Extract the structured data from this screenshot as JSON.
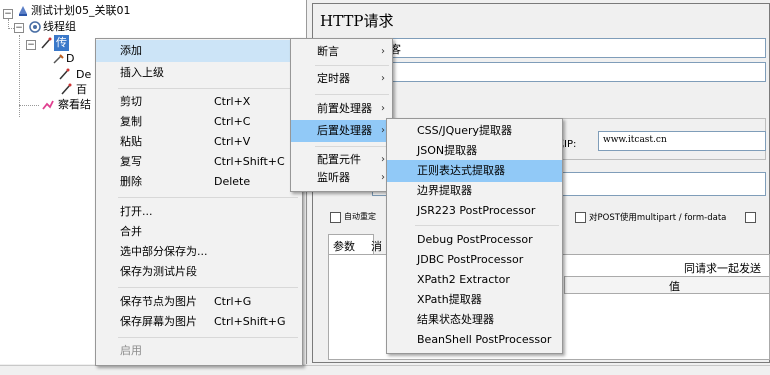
{
  "tree": {
    "items": [
      {
        "label": "测试计划05_关联01"
      },
      {
        "label": "线程组"
      },
      {
        "label": "传"
      },
      {
        "label": "D"
      },
      {
        "label": "De"
      },
      {
        "label": "百"
      },
      {
        "label": "察看结"
      }
    ]
  },
  "sampler": {
    "title": "HTTP请求",
    "name_value_partial": "客",
    "server_label_partial": "或IP:",
    "server_value": "www.itcast.cn",
    "checkbox_redirect": "自动重定",
    "checkbox_post": "对POST使用multipart / form-data",
    "tabs": [
      "参数",
      "消息"
    ],
    "send_params_partial": "同请求一起发送",
    "value_header": "值"
  },
  "context_menu": {
    "items": [
      {
        "label": "添加",
        "shortcut": "",
        "submenu": true
      },
      {
        "label": "插入上级",
        "shortcut": "",
        "submenu": true
      },
      {
        "label": "剪切",
        "shortcut": "Ctrl+X"
      },
      {
        "label": "复制",
        "shortcut": "Ctrl+C"
      },
      {
        "label": "粘贴",
        "shortcut": "Ctrl+V"
      },
      {
        "label": "复写",
        "shortcut": "Ctrl+Shift+C"
      },
      {
        "label": "删除",
        "shortcut": "Delete"
      },
      {
        "label": "打开..."
      },
      {
        "label": "合并"
      },
      {
        "label": "选中部分保存为..."
      },
      {
        "label": "保存为测试片段"
      },
      {
        "label": "保存节点为图片",
        "shortcut": "Ctrl+G"
      },
      {
        "label": "保存屏幕为图片",
        "shortcut": "Ctrl+Shift+G"
      },
      {
        "label": "启用"
      }
    ]
  },
  "add_submenu": {
    "items": [
      {
        "label": "断言"
      },
      {
        "label": "定时器"
      },
      {
        "label": "前置处理器"
      },
      {
        "label": "后置处理器"
      },
      {
        "label": "配置元件"
      },
      {
        "label": "监听器"
      }
    ]
  },
  "post_processor_submenu": {
    "items": [
      {
        "label": "CSS/JQuery提取器"
      },
      {
        "label": "JSON提取器"
      },
      {
        "label": "正则表达式提取器"
      },
      {
        "label": "边界提取器"
      },
      {
        "label": "JSR223 PostProcessor"
      },
      {
        "label": "Debug PostProcessor"
      },
      {
        "label": "JDBC PostProcessor"
      },
      {
        "label": "XPath2 Extractor"
      },
      {
        "label": "XPath提取器"
      },
      {
        "label": "结果状态处理器"
      },
      {
        "label": "BeanShell PostProcessor"
      }
    ]
  },
  "colors": {
    "highlight": "#91c9f7",
    "menu_bg": "#f2f2f2"
  }
}
